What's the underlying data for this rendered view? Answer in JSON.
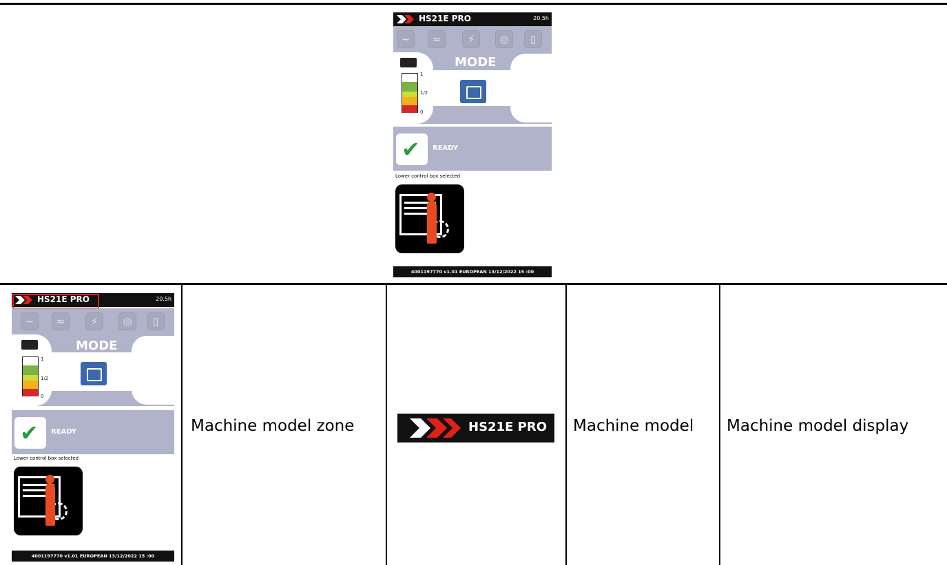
{
  "screen": {
    "model": "HS21E PRO",
    "hours": "20.5h",
    "mode_label": "MODE",
    "gauge": {
      "top": "1",
      "mid": "1/2",
      "bottom": "0"
    },
    "status": "READY",
    "lower_control": "Lower control box selected",
    "footer": "4001197770  v1.01  EUROPEAN  13/12/2022  15 :00"
  },
  "table": {
    "zone": "Machine model zone",
    "logo_text": "HS21E PRO",
    "element": "Machine model",
    "description": "Machine model display"
  },
  "colors": {
    "panel": "#b0b3c9",
    "battery_button": "#3b68ad",
    "ready_check": "#2c9a3c",
    "highlight": "#e0201b",
    "brand_red": "#e0201b"
  }
}
